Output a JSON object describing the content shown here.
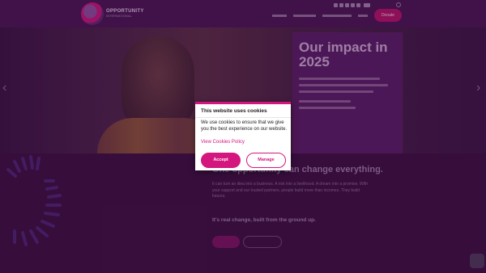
{
  "header": {
    "logo_text": "OPPORTUNITY",
    "logo_sub": "INTERNATIONAL",
    "donate_label": "Donate"
  },
  "hero": {
    "impact_title": "Our impact in 2025"
  },
  "main": {
    "tagline": "One opportunity can change everything.",
    "paragraph": "It can turn an idea into a business. A risk into a livelihood. A dream into a promise. With your support and our trusted partners, people build more than incomes. They build futures.",
    "paragraph2": "It's real change, built from the ground up."
  },
  "cookie_modal": {
    "title": "This website uses cookies",
    "body": "We use cookies to ensure that we give you the best experience on our website.",
    "link": "View Cookies Policy",
    "accept_label": "Accept",
    "manage_label": "Manage"
  },
  "colors": {
    "accent": "#d4167f",
    "page_bg": "#3c1140"
  }
}
